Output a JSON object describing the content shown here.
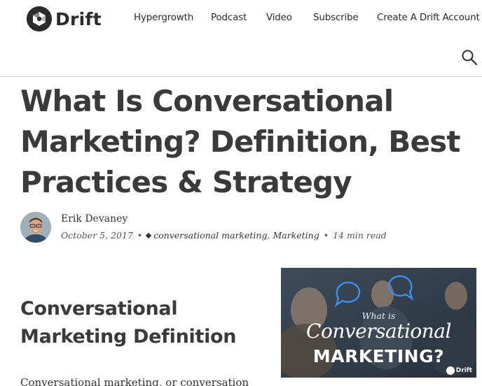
{
  "header": {
    "logo_text": "Drift",
    "nav": [
      {
        "label": "Hypergrowth"
      },
      {
        "label": "Podcast"
      },
      {
        "label": "Video"
      },
      {
        "label": "Subscribe"
      },
      {
        "label": "Create A Drift Account"
      }
    ]
  },
  "article": {
    "title": "What Is Conversational Marketing? Definition, Best Practices & Strategy",
    "author": "Erik Devaney",
    "date": "October 5, 2017",
    "categories": [
      "conversational marketing",
      "Marketing"
    ],
    "category_sep": ",",
    "read_time": "14 min read",
    "bullet": "•"
  },
  "section": {
    "heading": "Conversational Marketing Definition",
    "body_start": "Conversational marketing, or conversation"
  },
  "feature_image": {
    "line1": "What is",
    "line2": "Conversational",
    "line3": "MARKETING?",
    "badge": "Drift"
  }
}
